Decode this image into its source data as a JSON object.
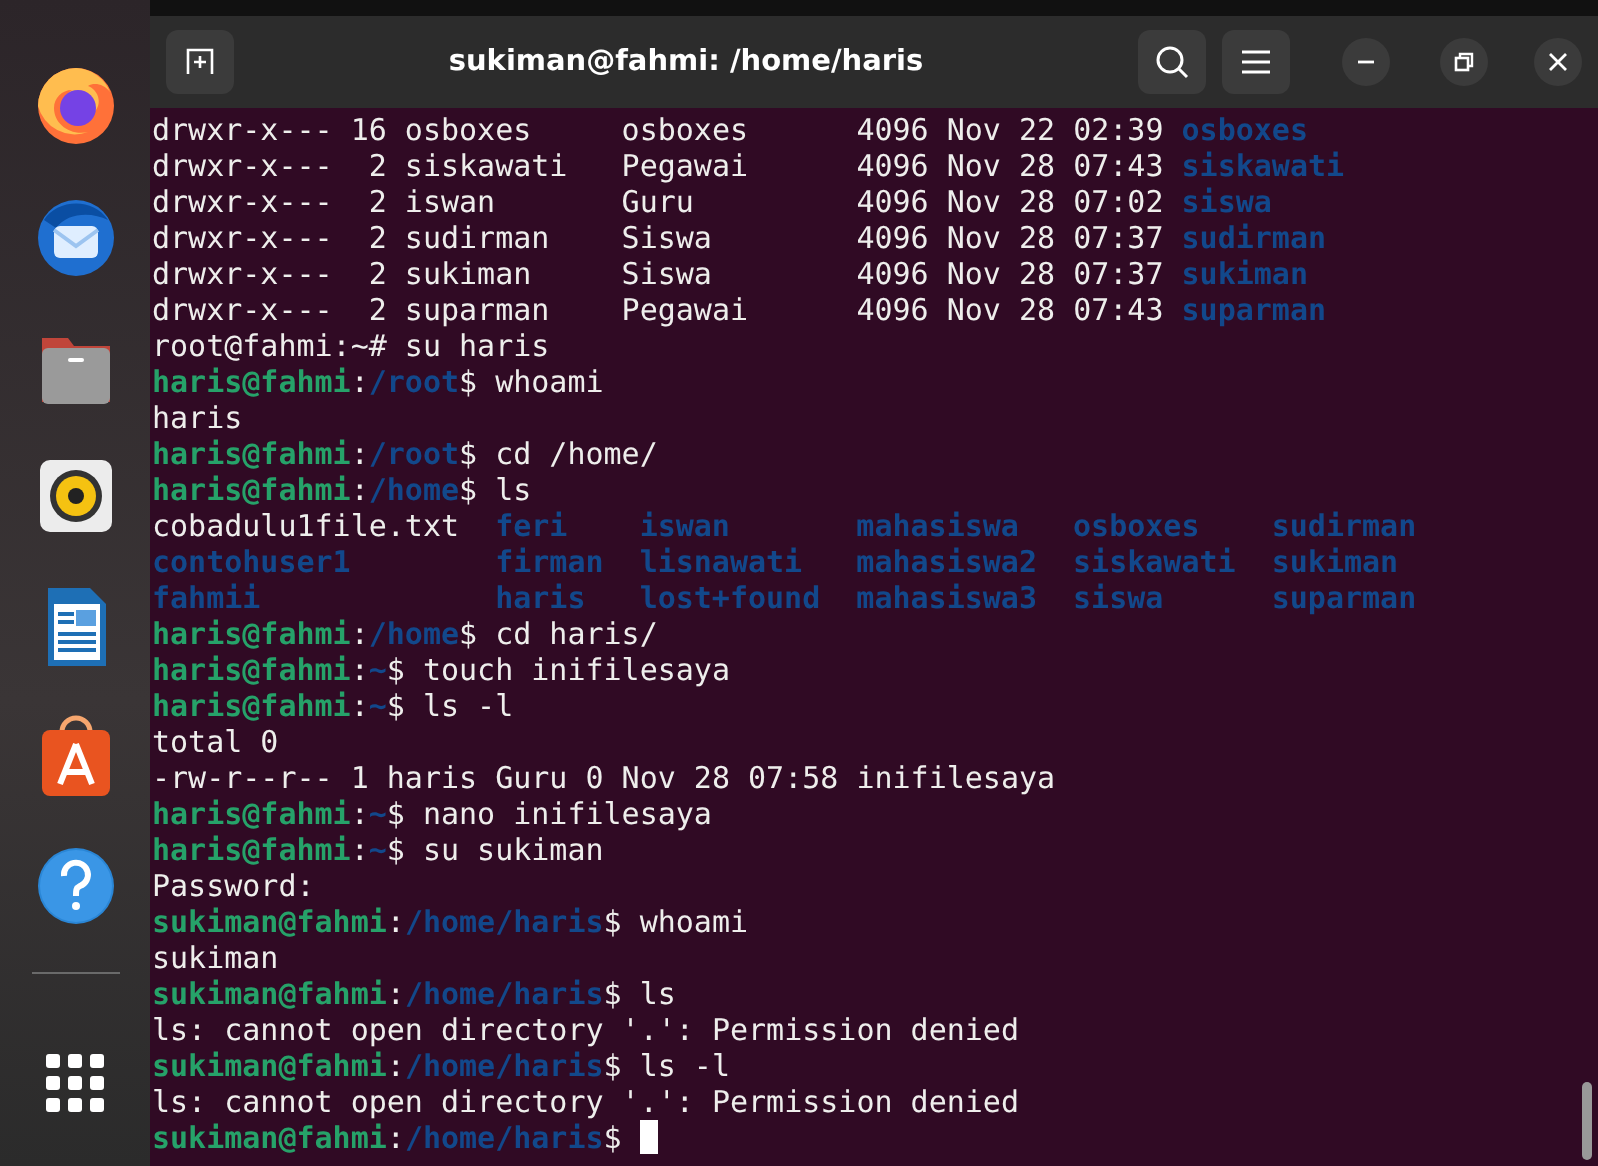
{
  "dock": {
    "apps": [
      {
        "kind": "firefox"
      },
      {
        "kind": "thunderbird"
      },
      {
        "kind": "files"
      },
      {
        "kind": "rhythmbox"
      },
      {
        "kind": "writer"
      },
      {
        "kind": "appcenter"
      },
      {
        "kind": "help"
      }
    ]
  },
  "window": {
    "title": "sukiman@fahmi: /home/haris"
  },
  "terminal": {
    "lines": [
      {
        "kind": "line",
        "segments": [
          {
            "kind": "text",
            "text": "drwxr-x--- 16 osboxes     osboxes      4096 Nov 22 02:39 "
          },
          {
            "kind": "dir",
            "text": "osboxes"
          }
        ]
      },
      {
        "kind": "line",
        "segments": [
          {
            "kind": "text",
            "text": "drwxr-x---  2 siskawati   Pegawai      4096 Nov 28 07:43 "
          },
          {
            "kind": "dir",
            "text": "siskawati"
          }
        ]
      },
      {
        "kind": "line",
        "segments": [
          {
            "kind": "text",
            "text": "drwxr-x---  2 iswan       Guru         4096 Nov 28 07:02 "
          },
          {
            "kind": "dir",
            "text": "siswa"
          }
        ]
      },
      {
        "kind": "line",
        "segments": [
          {
            "kind": "text",
            "text": "drwxr-x---  2 sudirman    Siswa        4096 Nov 28 07:37 "
          },
          {
            "kind": "dir",
            "text": "sudirman"
          }
        ]
      },
      {
        "kind": "line",
        "segments": [
          {
            "kind": "text",
            "text": "drwxr-x---  2 sukiman     Siswa        4096 Nov 28 07:37 "
          },
          {
            "kind": "dir",
            "text": "sukiman"
          }
        ]
      },
      {
        "kind": "line",
        "segments": [
          {
            "kind": "text",
            "text": "drwxr-x---  2 suparman    Pegawai      4096 Nov 28 07:43 "
          },
          {
            "kind": "dir",
            "text": "suparman"
          }
        ]
      },
      {
        "kind": "line",
        "segments": [
          {
            "kind": "text",
            "text": "root@fahmi:~# su haris"
          }
        ]
      },
      {
        "kind": "line",
        "segments": [
          {
            "kind": "user",
            "text": "haris@fahmi"
          },
          {
            "kind": "text",
            "text": ":"
          },
          {
            "kind": "path",
            "text": "/root"
          },
          {
            "kind": "text",
            "text": "$ whoami"
          }
        ]
      },
      {
        "kind": "line",
        "segments": [
          {
            "kind": "text",
            "text": "haris"
          }
        ]
      },
      {
        "kind": "line",
        "segments": [
          {
            "kind": "user",
            "text": "haris@fahmi"
          },
          {
            "kind": "text",
            "text": ":"
          },
          {
            "kind": "path",
            "text": "/root"
          },
          {
            "kind": "text",
            "text": "$ cd /home/"
          }
        ]
      },
      {
        "kind": "line",
        "segments": [
          {
            "kind": "user",
            "text": "haris@fahmi"
          },
          {
            "kind": "text",
            "text": ":"
          },
          {
            "kind": "path",
            "text": "/home"
          },
          {
            "kind": "text",
            "text": "$ ls"
          }
        ]
      },
      {
        "kind": "listing",
        "columns": [
          [
            {
              "kind": "text",
              "text": "cobadulu1file.txt"
            },
            {
              "kind": "dir",
              "text": "contohuser1"
            },
            {
              "kind": "dir",
              "text": "fahmii"
            }
          ],
          [
            {
              "kind": "dir",
              "text": "feri"
            },
            {
              "kind": "dir",
              "text": "firman"
            },
            {
              "kind": "dir",
              "text": "haris"
            }
          ],
          [
            {
              "kind": "dir",
              "text": "iswan"
            },
            {
              "kind": "dir",
              "text": "lisnawati"
            },
            {
              "kind": "dir",
              "text": "lost+found"
            }
          ],
          [
            {
              "kind": "dir",
              "text": "mahasiswa"
            },
            {
              "kind": "dir",
              "text": "mahasiswa2"
            },
            {
              "kind": "dir",
              "text": "mahasiswa3"
            }
          ],
          [
            {
              "kind": "dir",
              "text": "osboxes"
            },
            {
              "kind": "dir",
              "text": "siskawati"
            },
            {
              "kind": "dir",
              "text": "siswa"
            }
          ],
          [
            {
              "kind": "dir",
              "text": "sudirman"
            },
            {
              "kind": "dir",
              "text": "sukiman"
            },
            {
              "kind": "dir",
              "text": "suparman"
            }
          ]
        ]
      },
      {
        "kind": "line",
        "segments": [
          {
            "kind": "user",
            "text": "haris@fahmi"
          },
          {
            "kind": "text",
            "text": ":"
          },
          {
            "kind": "path",
            "text": "/home"
          },
          {
            "kind": "text",
            "text": "$ cd haris/"
          }
        ]
      },
      {
        "kind": "line",
        "segments": [
          {
            "kind": "user",
            "text": "haris@fahmi"
          },
          {
            "kind": "text",
            "text": ":"
          },
          {
            "kind": "path",
            "text": "~"
          },
          {
            "kind": "text",
            "text": "$ touch inifilesaya"
          }
        ]
      },
      {
        "kind": "line",
        "segments": [
          {
            "kind": "user",
            "text": "haris@fahmi"
          },
          {
            "kind": "text",
            "text": ":"
          },
          {
            "kind": "path",
            "text": "~"
          },
          {
            "kind": "text",
            "text": "$ ls -l"
          }
        ]
      },
      {
        "kind": "line",
        "segments": [
          {
            "kind": "text",
            "text": "total 0"
          }
        ]
      },
      {
        "kind": "line",
        "segments": [
          {
            "kind": "text",
            "text": "-rw-r--r-- 1 haris Guru 0 Nov 28 07:58 inifilesaya"
          }
        ]
      },
      {
        "kind": "line",
        "segments": [
          {
            "kind": "user",
            "text": "haris@fahmi"
          },
          {
            "kind": "text",
            "text": ":"
          },
          {
            "kind": "path",
            "text": "~"
          },
          {
            "kind": "text",
            "text": "$ nano inifilesaya"
          }
        ]
      },
      {
        "kind": "line",
        "segments": [
          {
            "kind": "user",
            "text": "haris@fahmi"
          },
          {
            "kind": "text",
            "text": ":"
          },
          {
            "kind": "path",
            "text": "~"
          },
          {
            "kind": "text",
            "text": "$ su sukiman"
          }
        ]
      },
      {
        "kind": "line",
        "segments": [
          {
            "kind": "text",
            "text": "Password:"
          }
        ]
      },
      {
        "kind": "line",
        "segments": [
          {
            "kind": "user",
            "text": "sukiman@fahmi"
          },
          {
            "kind": "text",
            "text": ":"
          },
          {
            "kind": "path",
            "text": "/home/haris"
          },
          {
            "kind": "text",
            "text": "$ whoami"
          }
        ]
      },
      {
        "kind": "line",
        "segments": [
          {
            "kind": "text",
            "text": "sukiman"
          }
        ]
      },
      {
        "kind": "line",
        "segments": [
          {
            "kind": "user",
            "text": "sukiman@fahmi"
          },
          {
            "kind": "text",
            "text": ":"
          },
          {
            "kind": "path",
            "text": "/home/haris"
          },
          {
            "kind": "text",
            "text": "$ ls"
          }
        ]
      },
      {
        "kind": "line",
        "segments": [
          {
            "kind": "text",
            "text": "ls: cannot open directory '.': Permission denied"
          }
        ]
      },
      {
        "kind": "line",
        "segments": [
          {
            "kind": "user",
            "text": "sukiman@fahmi"
          },
          {
            "kind": "text",
            "text": ":"
          },
          {
            "kind": "path",
            "text": "/home/haris"
          },
          {
            "kind": "text",
            "text": "$ ls -l"
          }
        ]
      },
      {
        "kind": "line",
        "segments": [
          {
            "kind": "text",
            "text": "ls: cannot open directory '.': Permission denied"
          }
        ]
      },
      {
        "kind": "line",
        "cursor": true,
        "segments": [
          {
            "kind": "user",
            "text": "sukiman@fahmi"
          },
          {
            "kind": "text",
            "text": ":"
          },
          {
            "kind": "path",
            "text": "/home/haris"
          },
          {
            "kind": "text",
            "text": "$"
          }
        ]
      }
    ]
  }
}
